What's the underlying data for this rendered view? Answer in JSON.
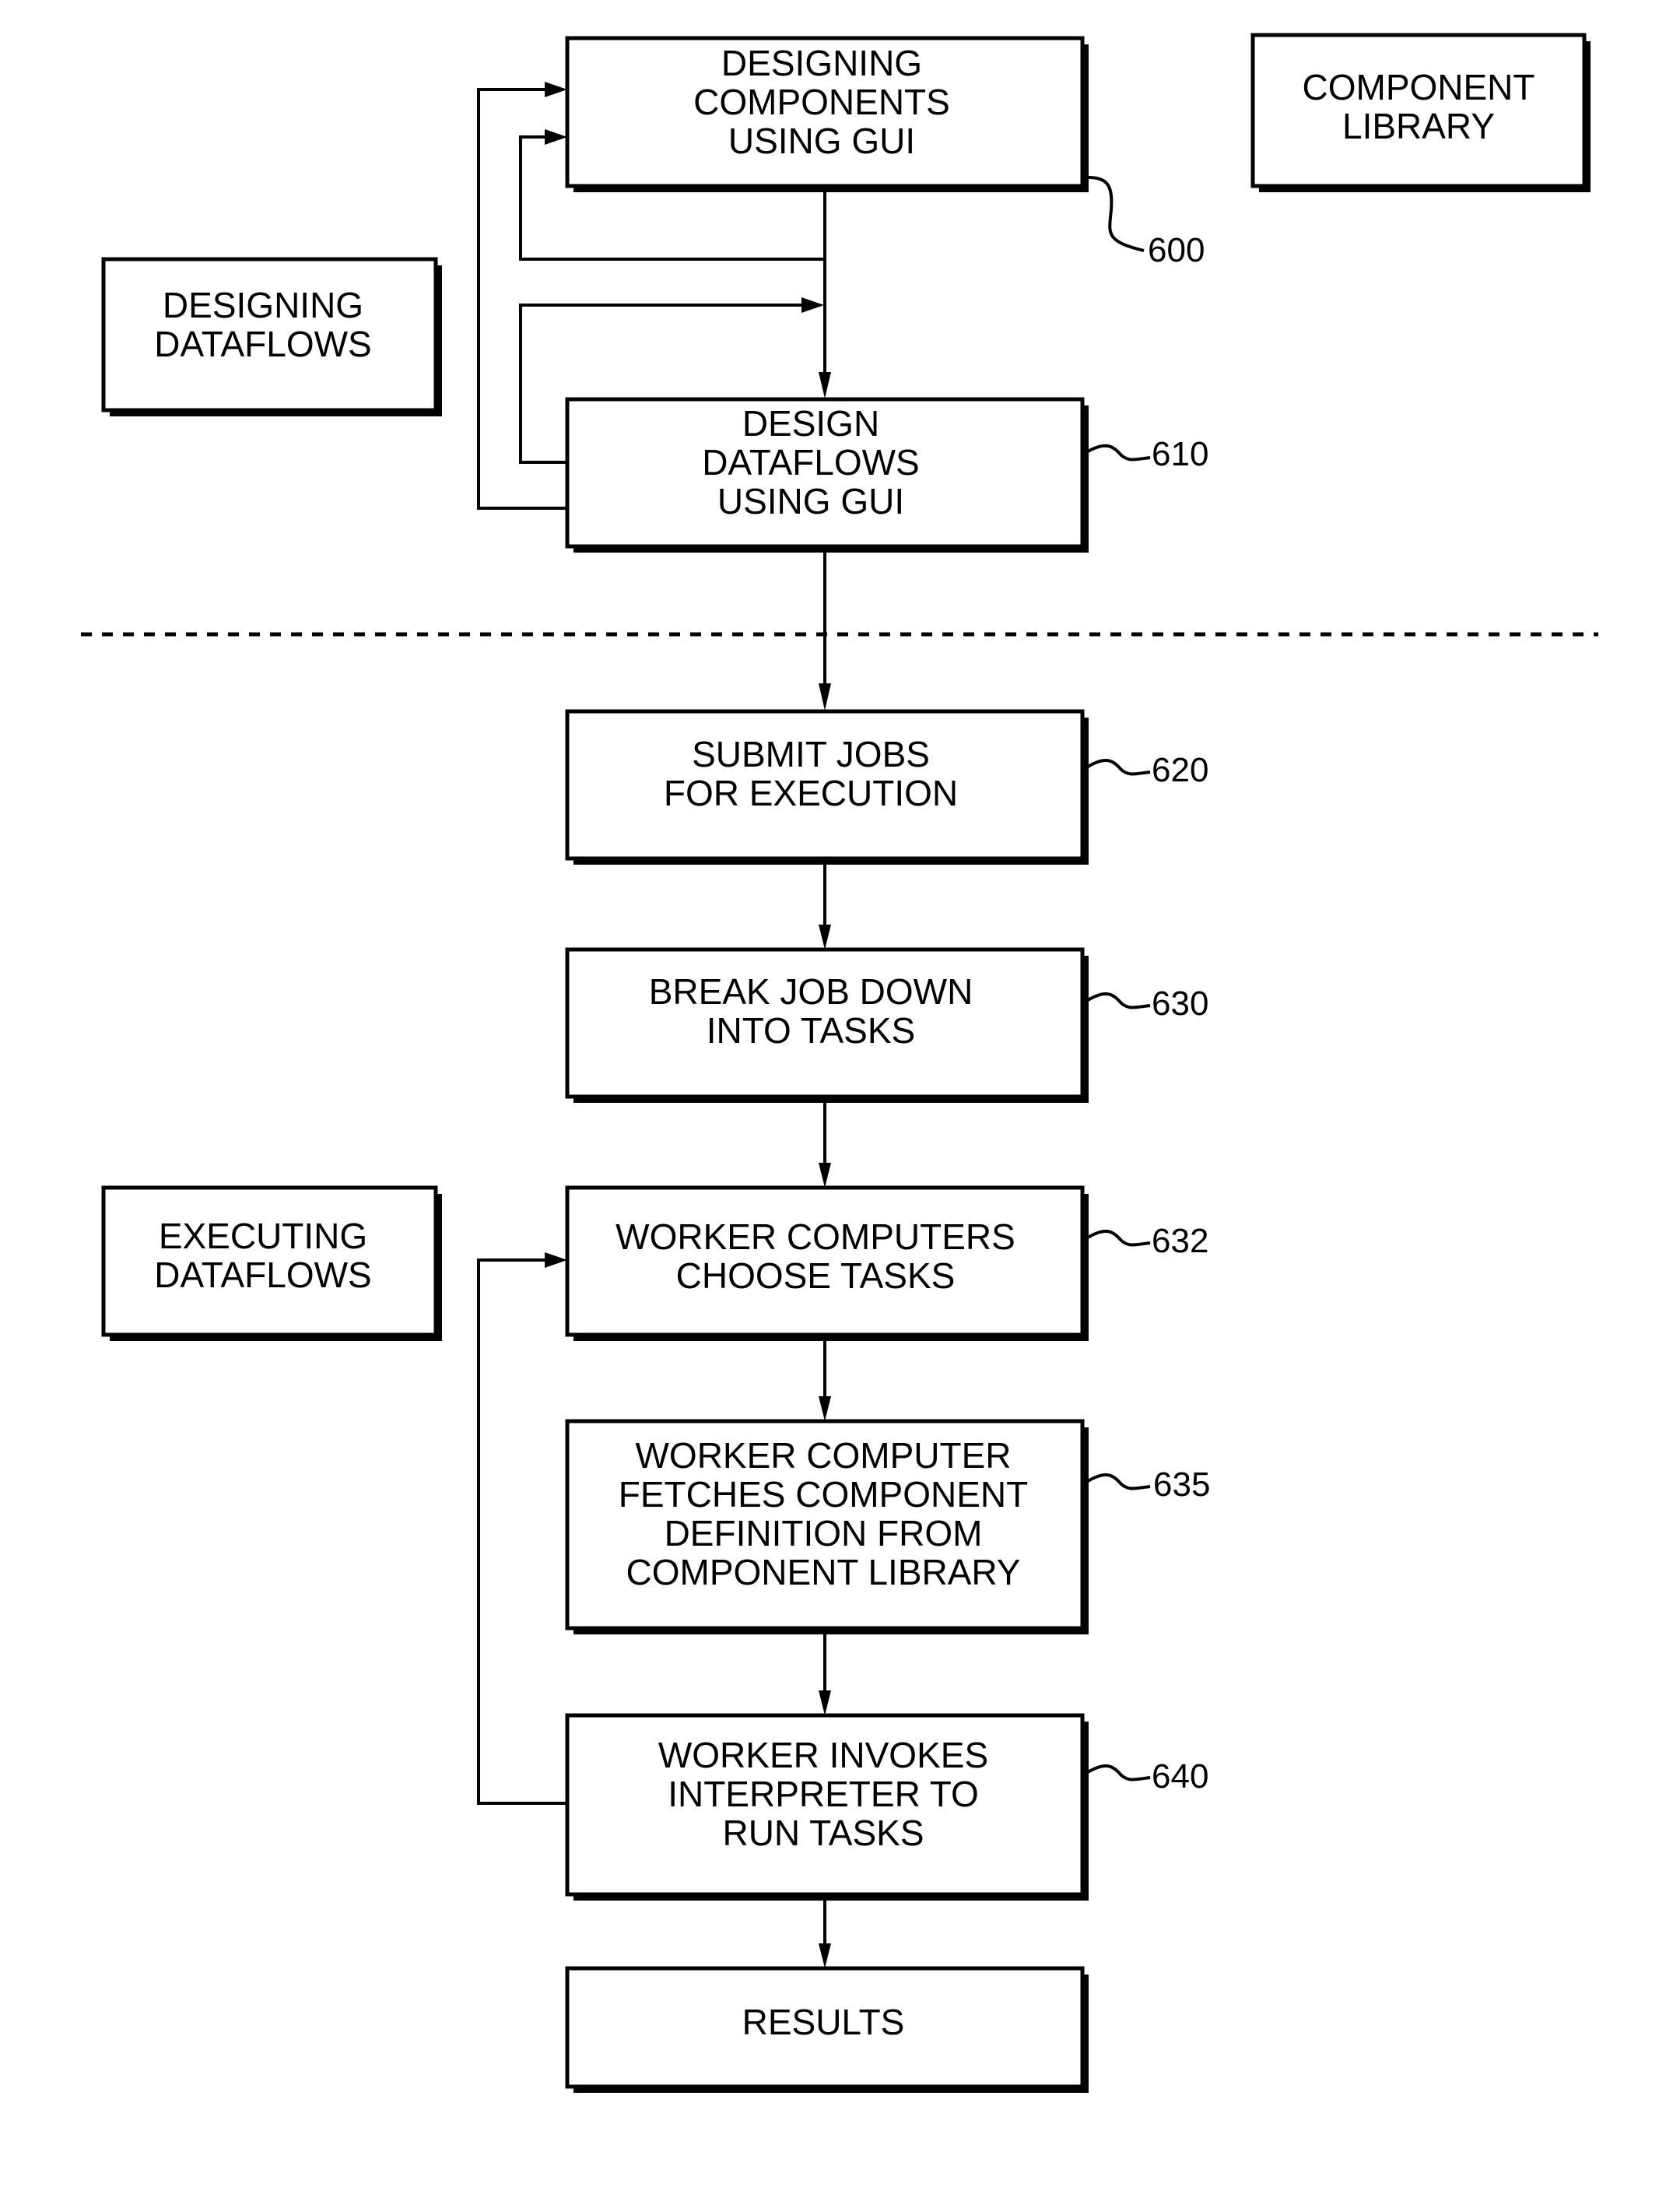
{
  "figure": {
    "section_labels": {
      "designing": [
        "DESIGNING",
        "DATAFLOWS"
      ],
      "executing": [
        "EXECUTING",
        "DATAFLOWS"
      ],
      "library": [
        "COMPONENT",
        "LIBRARY"
      ]
    },
    "steps": [
      {
        "id": "600",
        "ref": "600",
        "lines": [
          "DESIGNING",
          "COMPONENTS",
          "USING GUI"
        ]
      },
      {
        "id": "610",
        "ref": "610",
        "lines": [
          "DESIGN",
          "DATAFLOWS",
          "USING GUI"
        ]
      },
      {
        "id": "620",
        "ref": "620",
        "lines": [
          "SUBMIT JOBS",
          "FOR EXECUTION"
        ]
      },
      {
        "id": "630",
        "ref": "630",
        "lines": [
          "BREAK JOB DOWN",
          "INTO TASKS"
        ]
      },
      {
        "id": "632",
        "ref": "632",
        "lines": [
          "WORKER COMPUTERS",
          "CHOOSE TASKS"
        ]
      },
      {
        "id": "635",
        "ref": "635",
        "lines": [
          "WORKER COMPUTER",
          "FETCHES COMPONENT",
          "DEFINITION FROM",
          "COMPONENT LIBRARY"
        ]
      },
      {
        "id": "640",
        "ref": "640",
        "lines": [
          "WORKER INVOKES",
          "INTERPRETER TO",
          "RUN TASKS"
        ]
      },
      {
        "id": "results",
        "ref": null,
        "lines": [
          "RESULTS"
        ]
      }
    ]
  }
}
